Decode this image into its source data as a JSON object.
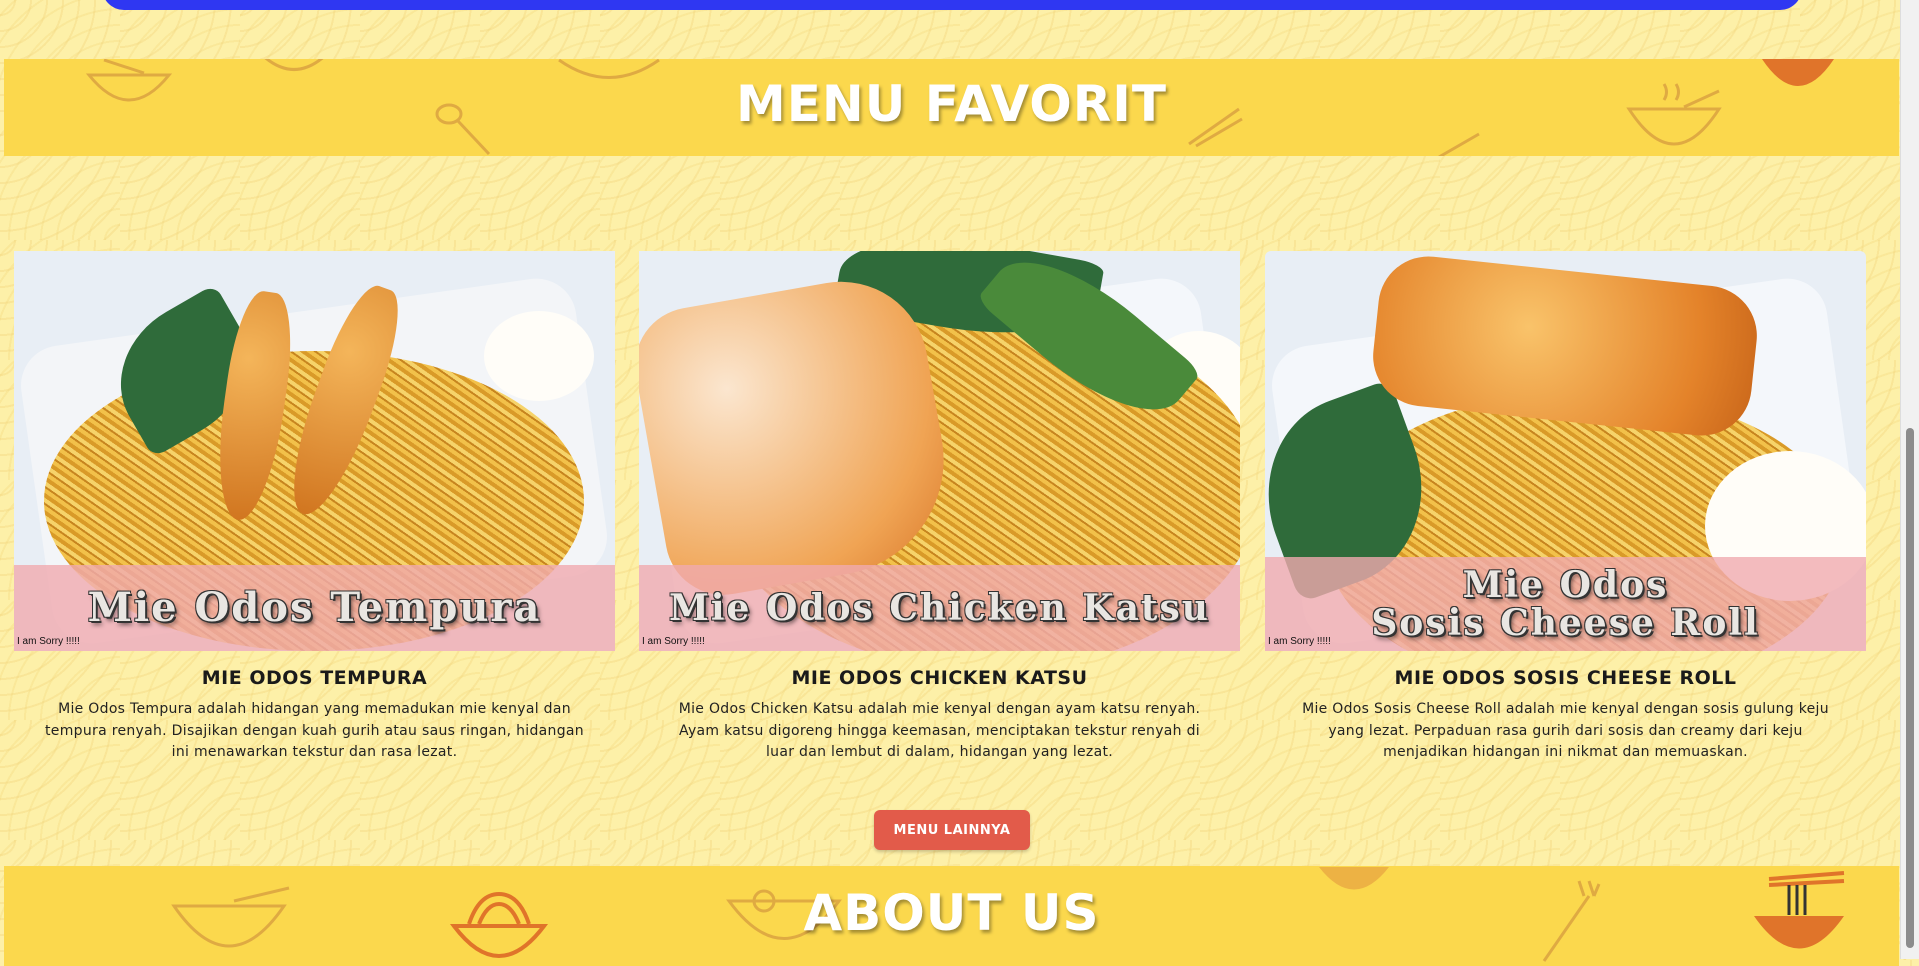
{
  "sections": {
    "menu_title": "MENU FAVORIT",
    "about_title": "ABOUT US"
  },
  "menu_items": [
    {
      "banner": "Mie Odos Tempura",
      "sorry": "I am Sorry !!!!!",
      "title": "MIE ODOS TEMPURA",
      "description": "Mie Odos Tempura adalah hidangan yang memadukan mie kenyal dan tempura renyah. Disajikan dengan kuah gurih atau saus ringan, hidangan ini menawarkan tekstur dan rasa lezat."
    },
    {
      "banner": "Mie Odos Chicken Katsu",
      "sorry": "I am Sorry !!!!!",
      "title": "MIE ODOS CHICKEN KATSU",
      "description": "Mie Odos Chicken Katsu adalah mie kenyal dengan ayam katsu renyah. Ayam katsu digoreng hingga keemasan, menciptakan tekstur renyah di luar dan lembut di dalam, hidangan yang lezat."
    },
    {
      "banner": "Mie Odos\nSosis Cheese Roll",
      "sorry": "I am Sorry !!!!!",
      "title": "MIE ODOS SOSIS CHEESE ROLL",
      "description": "Mie Odos Sosis Cheese Roll adalah mie kenyal dengan sosis gulung keju yang lezat. Perpaduan rasa gurih dari sosis dan creamy dari keju menjadikan hidangan ini nikmat dan memuaskan."
    }
  ],
  "more_button": "MENU LAINNYA",
  "colors": {
    "band": "#fbd84d",
    "button": "#e25b4a",
    "top_bar": "#2f37f2"
  }
}
